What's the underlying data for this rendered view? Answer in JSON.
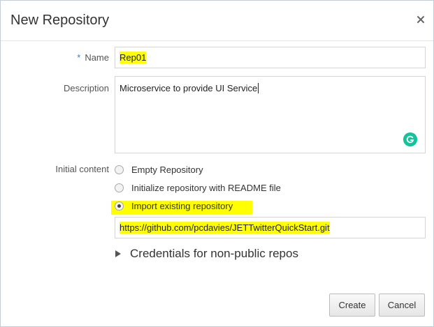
{
  "dialog": {
    "title": "New Repository",
    "close_icon": "close-icon"
  },
  "form": {
    "name": {
      "required_marker": "*",
      "label": "Name",
      "value": "Rep01"
    },
    "description": {
      "label": "Description",
      "value": "Microservice to provide UI Service",
      "extension_icon": "grammarly-icon"
    },
    "initial_content": {
      "label": "Initial content",
      "options": [
        {
          "label": "Empty Repository",
          "checked": false
        },
        {
          "label": "Initialize repository with README file",
          "checked": false
        },
        {
          "label": "Import existing repository",
          "checked": true
        }
      ],
      "import_url": "https://github.com/pcdavies/JETTwitterQuickStart.git"
    },
    "credentials": {
      "label": "Credentials for non-public repos",
      "expand_icon": "triangle-right-icon"
    }
  },
  "buttons": {
    "create": "Create",
    "cancel": "Cancel"
  },
  "colors": {
    "highlight": "#ffff00",
    "required": "#3a7fc1",
    "grammarly": "#15c39a"
  }
}
